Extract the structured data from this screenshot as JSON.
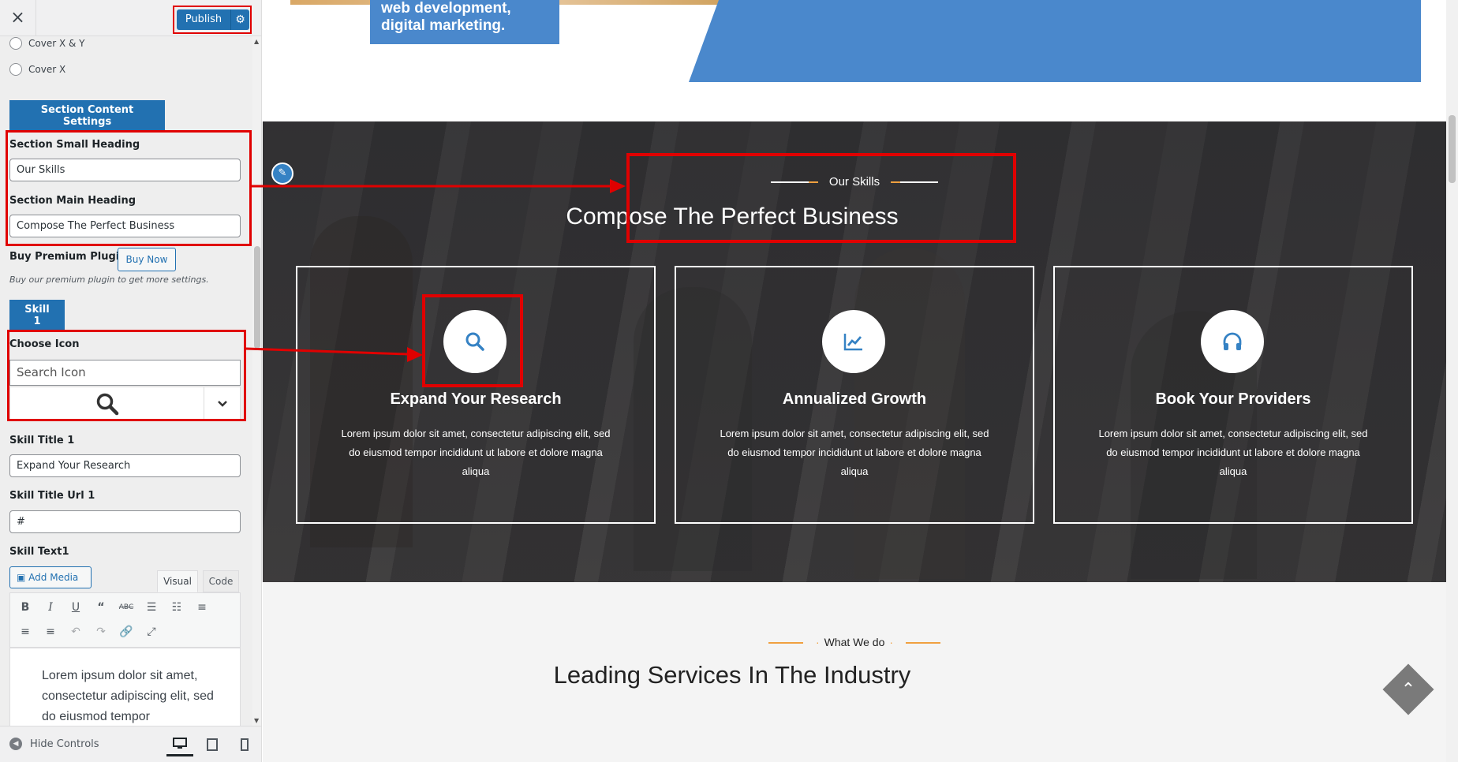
{
  "sidebar": {
    "close_icon": "×",
    "publish_label": "Publish",
    "radio_options": [
      "Cover X & Y",
      "Cover X"
    ],
    "section_content_title": "Section Content Settings",
    "small_heading_label": "Section Small Heading",
    "small_heading_value": "Our Skills",
    "main_heading_label": "Section Main Heading",
    "main_heading_value": "Compose The Perfect Business",
    "buy_label": "Buy Premium Plugin",
    "buy_button": "Buy Now",
    "buy_desc": "Buy our premium plugin to get more settings.",
    "skill_tag": "Skill 1",
    "choose_icon_label": "Choose Icon",
    "icon_search_placeholder": "Search Icon",
    "skill_title_label": "Skill Title 1",
    "skill_title_value": "Expand Your Research",
    "skill_url_label": "Skill Title Url 1",
    "skill_url_value": "#",
    "skill_text_label": "Skill Text1",
    "add_media": "Add Media",
    "tab_visual": "Visual",
    "tab_code": "Code",
    "editor_text": "Lorem ipsum dolor sit amet, consectetur adipiscing elit, sed do eiusmod tempor",
    "hide_controls": "Hide Controls"
  },
  "preview": {
    "hero_caption": "web development, digital marketing.",
    "skills_small_heading": "Our Skills",
    "skills_main_heading": "Compose The Perfect Business",
    "skills": [
      {
        "title": "Expand Your Research",
        "text": "Lorem ipsum dolor sit amet, consectetur adipiscing elit, sed do eiusmod tempor incididunt ut labore et dolore magna aliqua",
        "icon": "search-icon"
      },
      {
        "title": "Annualized Growth",
        "text": "Lorem ipsum dolor sit amet, consectetur adipiscing elit, sed do eiusmod tempor incididunt ut labore et dolore magna aliqua",
        "icon": "chart-line-icon"
      },
      {
        "title": "Book Your Providers",
        "text": "Lorem ipsum dolor sit amet, consectetur adipiscing elit, sed do eiusmod tempor incididunt ut labore et dolore magna aliqua",
        "icon": "headphones-icon"
      }
    ],
    "services_small_heading": "What We do",
    "services_main_heading": "Leading Services In The Industry"
  },
  "colors": {
    "accent_blue": "#2271b1",
    "annotation_red": "#e00000",
    "hero_blue": "#4a88cc",
    "orange_line": "#f0a040",
    "icon_blue": "#3582c4"
  }
}
